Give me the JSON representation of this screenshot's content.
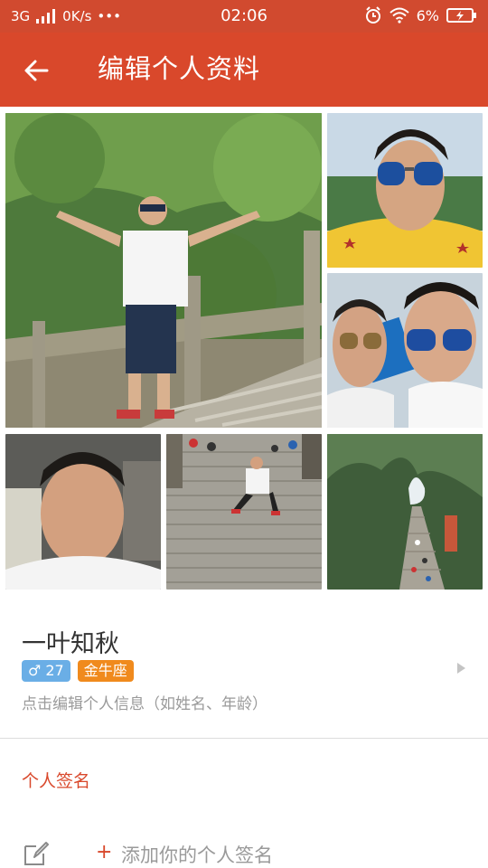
{
  "status_bar": {
    "network": "3G",
    "speed": "0K/s",
    "dots": "•••",
    "time": "02:06",
    "battery": "6%"
  },
  "toolbar": {
    "title": "编辑个人资料"
  },
  "profile": {
    "name": "一叶知秋",
    "gender_symbol": "♂",
    "age": "27",
    "zodiac": "金牛座",
    "edit_hint": "点击编辑个人信息（如姓名、年龄）"
  },
  "signature": {
    "section_label": "个人签名",
    "plus": "+",
    "placeholder": "添加你的个人签名"
  },
  "colors": {
    "accent": "#d9482b",
    "gender_badge": "#6aaee6",
    "zodiac_badge": "#f08a1d"
  }
}
